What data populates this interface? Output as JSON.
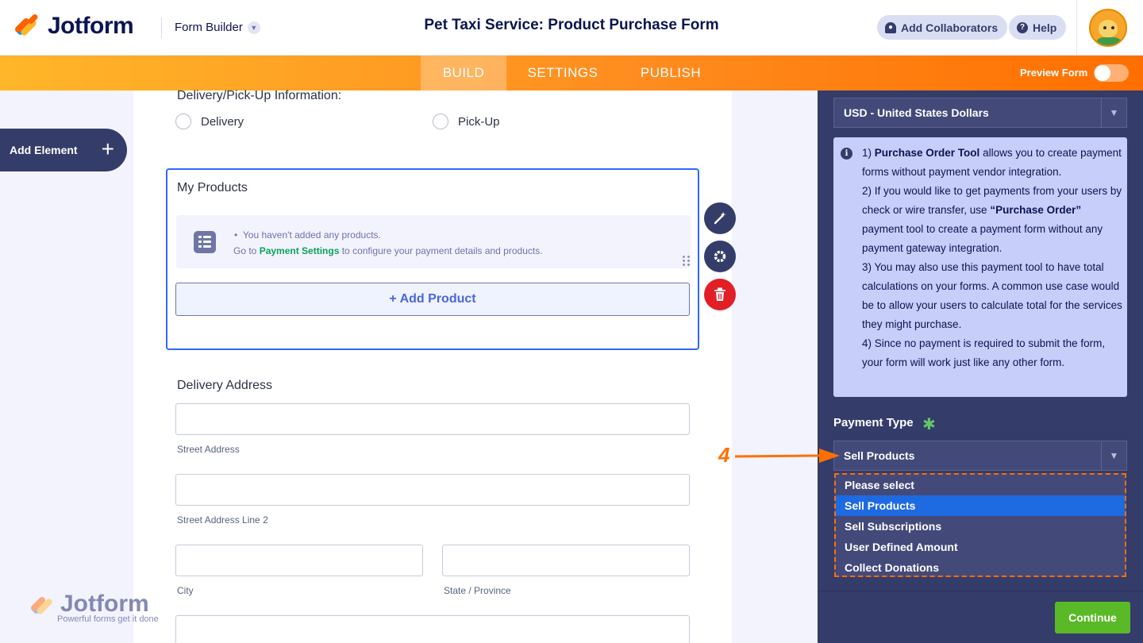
{
  "header": {
    "logo_text": "Jotform",
    "form_builder_label": "Form Builder",
    "form_title": "Pet Taxi Service: Product Purchase Form",
    "add_collaborators_label": "Add Collaborators",
    "help_label": "Help"
  },
  "nav": {
    "tabs": [
      {
        "label": "BUILD",
        "active": true
      },
      {
        "label": "SETTINGS",
        "active": false
      },
      {
        "label": "PUBLISH",
        "active": false
      }
    ],
    "preview_form_label": "Preview Form",
    "preview_form_enabled": false
  },
  "left_panel": {
    "add_element_label": "Add Element"
  },
  "form": {
    "delivery_question": "Delivery/Pick-Up Information:",
    "delivery_options": [
      "Delivery",
      "Pick-Up"
    ],
    "products_title": "My Products",
    "empty_message": "You haven't added any products.",
    "empty_hint_prefix": "Go to ",
    "empty_hint_link": "Payment Settings",
    "empty_hint_suffix": " to configure your payment details and products.",
    "add_product_label": "+ Add Product",
    "address_title": "Delivery Address",
    "street_label": "Street Address",
    "street2_label": "Street Address Line 2",
    "city_label": "City",
    "state_label": "State / Province"
  },
  "watermark": {
    "text": "Jotform",
    "tagline": "Powerful forms get it done"
  },
  "right_panel": {
    "currency_value": "USD - United States Dollars",
    "info": {
      "p1_bold": "Purchase Order Tool",
      "p1_prefix": "1) ",
      "p1_rest": " allows you to create payment forms without payment vendor integration.",
      "p2_prefix": "2) If you would like to get payments from your users by check or wire transfer, use ",
      "p2_bold": "“Purchase Order”",
      "p2_rest": " payment tool to create a payment form without any payment gateway integration.",
      "p3": "3) You may also use this payment tool to have total calculations on your forms. A common use case would be to allow your users to calculate total for the services they might purchase.",
      "p4": "4) Since no payment is required to submit the form, your form will work just like any other form."
    },
    "payment_type_label": "Payment Type",
    "payment_type_value": "Sell Products",
    "payment_type_options": [
      "Please select",
      "Sell Products",
      "Sell Subscriptions",
      "User Defined Amount",
      "Collect Donations"
    ],
    "payment_type_selected_index": 1,
    "continue_label": "Continue"
  },
  "annotation": {
    "step_number": "4"
  },
  "colors": {
    "brand_dark": "#0a1551",
    "orange": "#ff6f00",
    "panel_bg": "#343c6a",
    "selected_blue": "#1e6ae1",
    "continue_green": "#5ab926"
  }
}
